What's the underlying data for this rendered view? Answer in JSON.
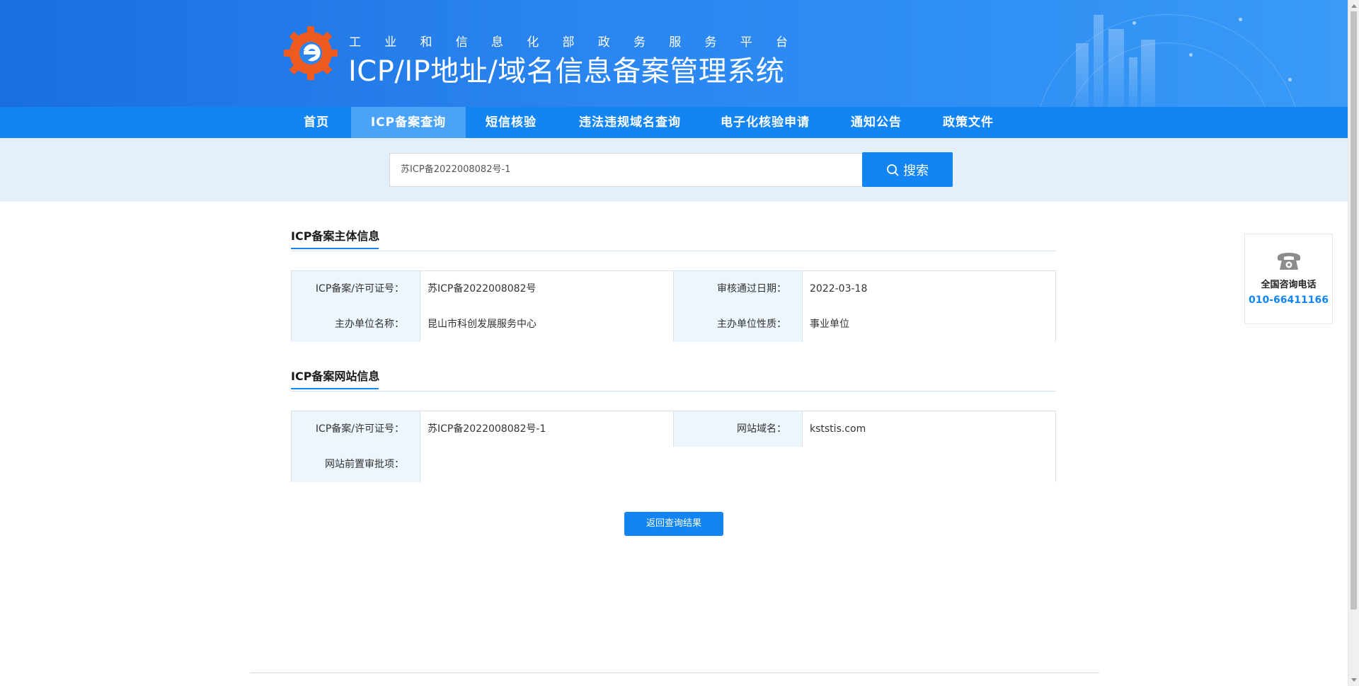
{
  "header": {
    "subtitle_chars": [
      "工",
      "业",
      "和",
      "信",
      "息",
      "化",
      "部",
      "政",
      "务",
      "服",
      "务",
      "平",
      "台"
    ],
    "title": "ICP/IP地址/域名信息备案管理系统"
  },
  "nav": {
    "items": [
      {
        "label": "首页"
      },
      {
        "label": "ICP备案查询"
      },
      {
        "label": "短信核验"
      },
      {
        "label": "违法违规域名查询"
      },
      {
        "label": "电子化核验申请"
      },
      {
        "label": "通知公告"
      },
      {
        "label": "政策文件"
      }
    ],
    "active_index": 1
  },
  "search": {
    "value": "苏ICP备2022008082号-1",
    "button_label": "搜索"
  },
  "subject_section": {
    "title": "ICP备案主体信息",
    "rows": [
      [
        {
          "label": "ICP备案/许可证号：",
          "value": "苏ICP备2022008082号"
        },
        {
          "label": "审核通过日期：",
          "value": "2022-03-18"
        }
      ],
      [
        {
          "label": "主办单位名称：",
          "value": "昆山市科创发展服务中心"
        },
        {
          "label": "主办单位性质：",
          "value": "事业单位"
        }
      ]
    ]
  },
  "website_section": {
    "title": "ICP备案网站信息",
    "row1": [
      {
        "label": "ICP备案/许可证号：",
        "value": "苏ICP备2022008082号-1"
      },
      {
        "label": "网站域名：",
        "value": "kststis.com"
      }
    ],
    "row2": {
      "label": "网站前置审批项：",
      "value": ""
    }
  },
  "back_button": {
    "label": "返回查询结果"
  },
  "consult": {
    "icon": "telephone-icon",
    "label": "全国咨询电话",
    "number": "010-66411166"
  },
  "colors": {
    "primary": "#1285f2",
    "nav_active": "#4aa3f7",
    "search_band": "#e3f0fc",
    "label_bg": "#edf5fd",
    "logo_orange": "#ee5a1f"
  }
}
